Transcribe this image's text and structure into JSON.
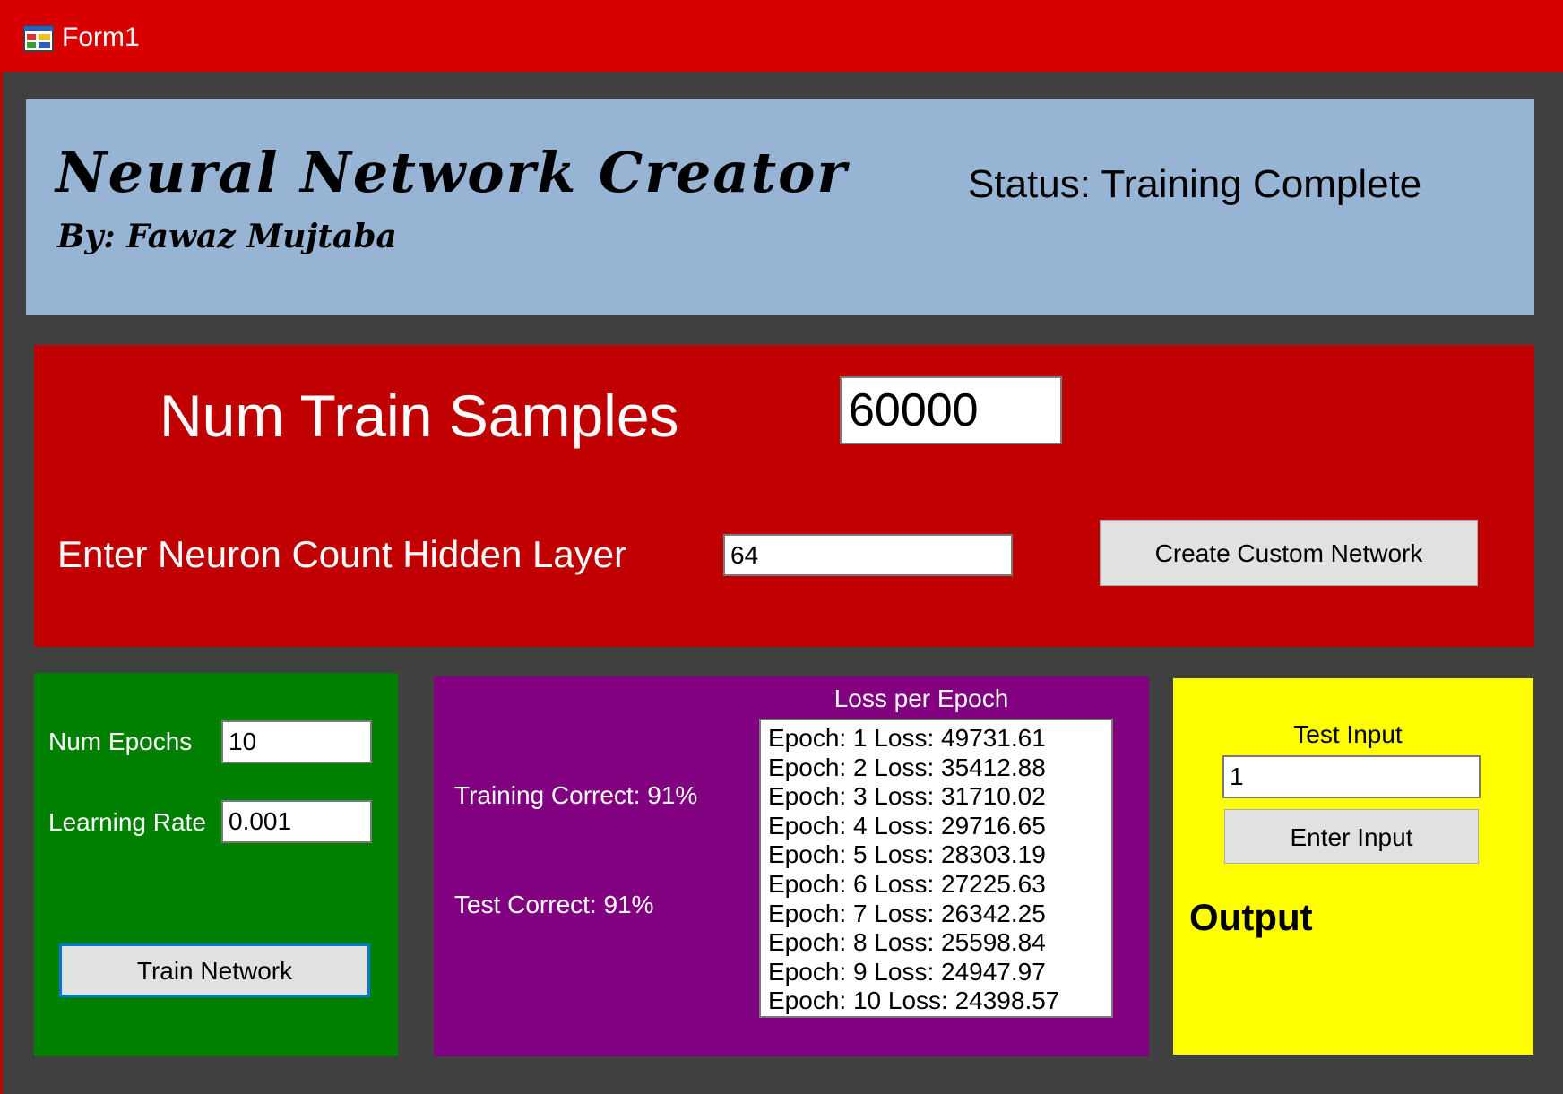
{
  "window": {
    "title": "Form1"
  },
  "header": {
    "app_title": "Neural Network Creator",
    "author": "By: Fawaz Mujtaba",
    "status": "Status: Training Complete"
  },
  "config": {
    "samples_label": "Num Train Samples",
    "samples_value": "60000",
    "neuron_label": "Enter Neuron Count Hidden Layer",
    "neuron_value": "64",
    "create_button": "Create Custom Network"
  },
  "training": {
    "epochs_label": "Num Epochs",
    "epochs_value": "10",
    "lr_label": "Learning Rate",
    "lr_value": "0.001",
    "train_button": "Train Network"
  },
  "results": {
    "training_correct": "Training Correct: 91%",
    "test_correct": "Test Correct: 91%",
    "loss_title": "Loss per Epoch",
    "loss_items": [
      "Epoch: 1 Loss: 49731.61",
      "Epoch: 2 Loss: 35412.88",
      "Epoch: 3 Loss: 31710.02",
      "Epoch: 4 Loss: 29716.65",
      "Epoch: 5 Loss: 28303.19",
      "Epoch: 6 Loss: 27225.63",
      "Epoch: 7 Loss: 26342.25",
      "Epoch: 8 Loss: 25598.84",
      "Epoch: 9 Loss: 24947.97",
      "Epoch: 10 Loss: 24398.57"
    ]
  },
  "test": {
    "label": "Test Input",
    "value": "1",
    "enter_button": "Enter Input",
    "output_label": "Output"
  },
  "colors": {
    "titlebar": "#d90000",
    "background": "#404040",
    "header_panel": "#98b4d4",
    "config_panel": "#c00000",
    "training_panel": "#008000",
    "results_panel": "#800080",
    "test_panel": "#ffff00"
  }
}
